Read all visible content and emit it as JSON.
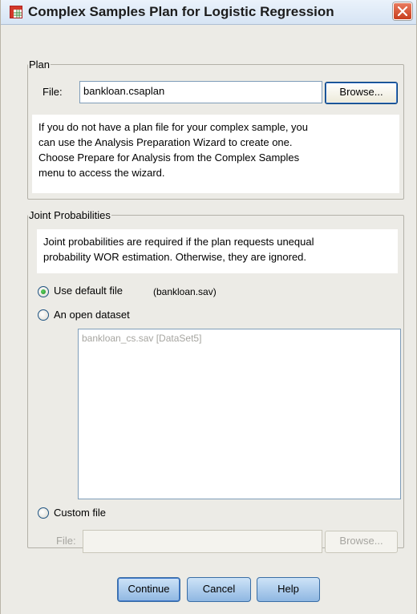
{
  "window": {
    "title": "Complex Samples Plan for Logistic Regression",
    "close_icon": "close-icon",
    "app_icon": "table-grid-icon"
  },
  "plan": {
    "legend": "Plan",
    "file_label": "File:",
    "file_value": "bankloan.csaplan",
    "browse_label": "Browse...",
    "info_lines": [
      "If you do not have a plan file for your complex sample, you",
      "can use the Analysis Preparation Wizard to create one.",
      "Choose Prepare for Analysis from the Complex Samples",
      "menu to access the wizard."
    ]
  },
  "joint": {
    "legend": "Joint Probabilities",
    "info_lines": [
      "Joint probabilities are required if the plan requests unequal",
      "probability WOR estimation. Otherwise, they are ignored."
    ],
    "options": {
      "default_label": "Use default file",
      "default_file": "(bankloan.sav)",
      "open_label": "An open dataset",
      "custom_label": "Custom file"
    },
    "selected": "default",
    "datasets": [
      "bankloan_cs.sav [DataSet5]"
    ],
    "custom_file_label": "File:",
    "custom_file_value": "",
    "custom_browse_label": "Browse..."
  },
  "buttons": {
    "continue": "Continue",
    "cancel": "Cancel",
    "help": "Help"
  }
}
